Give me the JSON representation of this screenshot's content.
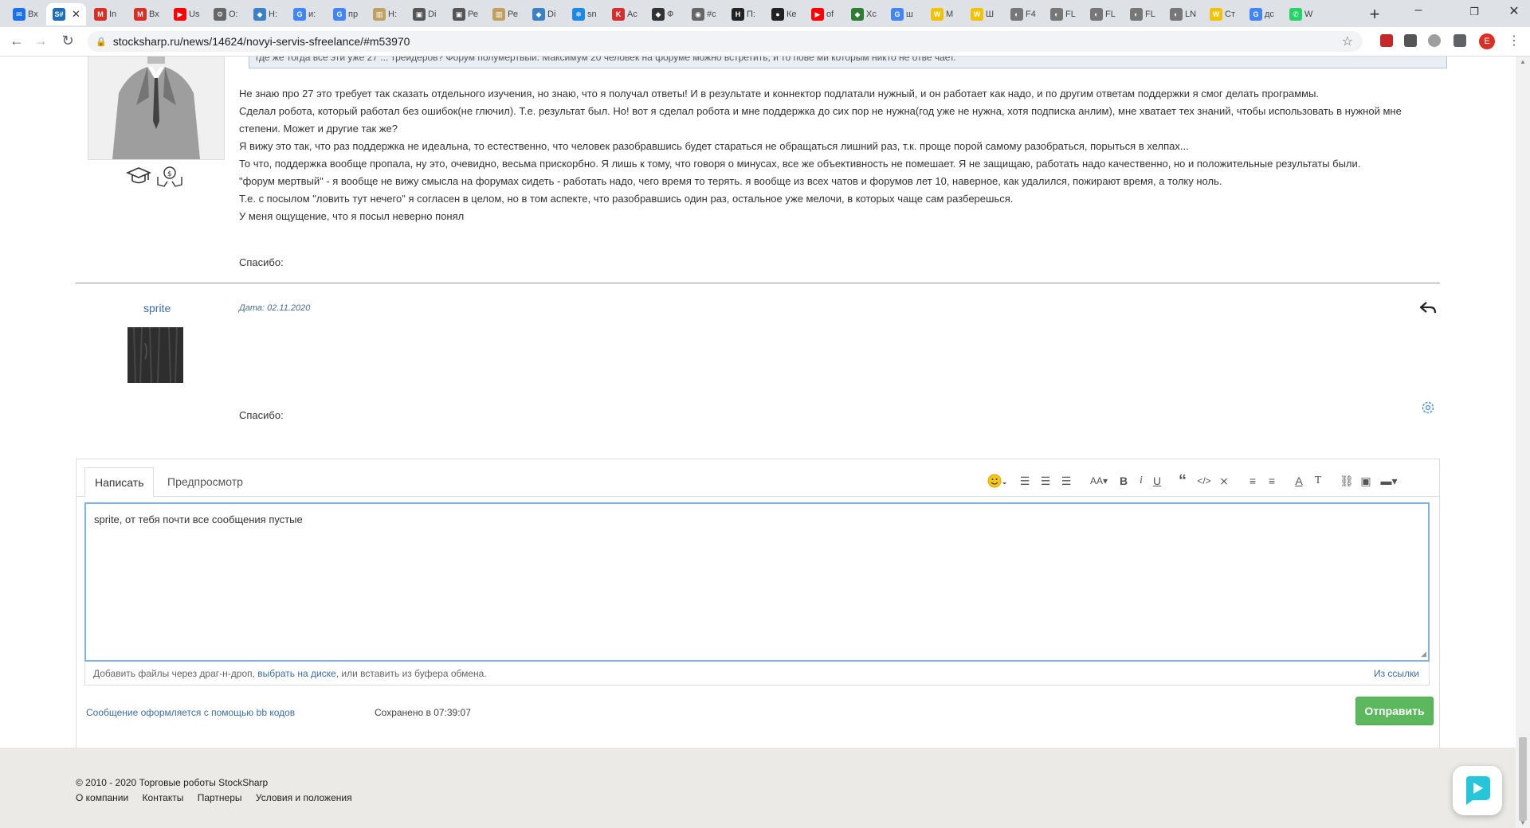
{
  "browser": {
    "tabs": [
      {
        "label": "Вх",
        "icon": "mail-icon",
        "color": "#1a73e8"
      },
      {
        "label": "",
        "icon": "stocksharp-icon",
        "color": "#1e6fb8",
        "active": true
      },
      {
        "label": "In",
        "icon": "gmail-icon",
        "color": "#d93025"
      },
      {
        "label": "Вх",
        "icon": "gmail-icon",
        "color": "#d93025"
      },
      {
        "label": "Us",
        "icon": "youtube-icon",
        "color": "#ff0000"
      },
      {
        "label": "O:",
        "icon": "gear-icon",
        "color": "#666666"
      },
      {
        "label": "Н:",
        "icon": "site-icon",
        "color": "#3b82c4"
      },
      {
        "label": "и:",
        "icon": "google-icon",
        "color": "#4285f4"
      },
      {
        "label": "пр",
        "icon": "google-icon",
        "color": "#4285f4"
      },
      {
        "label": "Н:",
        "icon": "chart-icon",
        "color": "#c0a060"
      },
      {
        "label": "Di",
        "icon": "photo-icon",
        "color": "#555555"
      },
      {
        "label": "Ре",
        "icon": "photo-icon",
        "color": "#555555"
      },
      {
        "label": "Ре",
        "icon": "chart-icon",
        "color": "#c0a060"
      },
      {
        "label": "Di",
        "icon": "site-icon",
        "color": "#3b82c4"
      },
      {
        "label": "sn",
        "icon": "snowflake-icon",
        "color": "#1e88e5"
      },
      {
        "label": "Ас",
        "icon": "kaspersky-icon",
        "color": "#d32f2f"
      },
      {
        "label": "Ф",
        "icon": "site-icon",
        "color": "#333333"
      },
      {
        "label": "#с",
        "icon": "camera-icon",
        "color": "#666666"
      },
      {
        "label": "П:",
        "icon": "h-icon",
        "color": "#222222"
      },
      {
        "label": "Ке",
        "icon": "github-icon",
        "color": "#222222"
      },
      {
        "label": "of",
        "icon": "youtube-icon",
        "color": "#ff0000"
      },
      {
        "label": "Хс",
        "icon": "site-icon",
        "color": "#2e7d32"
      },
      {
        "label": "ш",
        "icon": "google-icon",
        "color": "#4285f4"
      },
      {
        "label": "М",
        "icon": "w-icon",
        "color": "#f2c200"
      },
      {
        "label": "Ш",
        "icon": "w-icon",
        "color": "#f2c200"
      },
      {
        "label": "F4",
        "icon": "firefox-icon",
        "color": "#777777"
      },
      {
        "label": "FL",
        "icon": "firefox-icon",
        "color": "#777777"
      },
      {
        "label": "FL",
        "icon": "firefox-icon",
        "color": "#777777"
      },
      {
        "label": "FL",
        "icon": "firefox-icon",
        "color": "#777777"
      },
      {
        "label": "LN",
        "icon": "firefox-icon",
        "color": "#777777"
      },
      {
        "label": "Ст",
        "icon": "w-icon",
        "color": "#f2c200"
      },
      {
        "label": "дс",
        "icon": "google-icon",
        "color": "#4285f4"
      },
      {
        "label": "W",
        "icon": "whatsapp-icon",
        "color": "#25d366"
      }
    ],
    "url": "stocksharp.ru/news/14624/novyi-servis-sfreelance/#m53970",
    "profile_initial": "E"
  },
  "post1": {
    "quote_tail": "где же тогда все эти уже 27 ... трейдеров? Форум полумертвый. Максимум 20 человек на форуме можно встретить, и то пове ми которым никто не отве чает.",
    "lines": [
      "Не знаю про 27 это требует так сказать отдельного изучения, но знаю, что я получал ответы! И в результате и коннектор подлатали нужный, и он работает как надо, и по другим ответам поддержки я смог делать программы.",
      "Сделал робота, который работал без ошибок(не глючил). Т.е. результат был. Но! вот я сделал робота и мне поддержка до сих пор не нужна(год уже не нужна, хотя подписка анлим), мне хватает тех знаний, чтобы использовать в нужной мне степени. Может и другие так же?",
      "Я вижу это так, что раз поддержка не идеальна, то естественно, что человек разобравшись будет стараться не обращаться лишний раз, т.к. проще порой самому разобраться, порыться в хелпах...",
      "То что, поддержка вообще пропала, ну это, очевидно, весьма прискорбно. Я лишь к тому, что говоря о минусах, все же объективность не помешает. Я не защищаю, работать надо качественно, но и положительные результаты были.",
      "\"форум мертвый\" - я вообще не вижу смысла на форумах сидеть - работать надо, чего время то терять. я вообще из всех чатов и форумов лет 10, наверное, как удалился, пожирают время, а толку ноль.",
      "Т.е. с посылом \"ловить тут нечего\" я согласен в целом, но в том аспекте, что разобравшись один раз, остальное уже мелочи, в которых чаще сам разберешься.",
      "У меня ощущение, что я посыл неверно понял"
    ],
    "thanks": "Спасибо:"
  },
  "post2": {
    "author": "sprite",
    "date": "Дата: 02.11.2020",
    "thanks": "Спасибо:"
  },
  "editor": {
    "tab_write": "Написать",
    "tab_preview": "Предпросмотр",
    "text": "sprite, от тебя почти все сообщения пустые",
    "drop_text_1": "Добавить файлы через драг-н-дроп, ",
    "drop_link": "выбрать на диске",
    "drop_text_2": ", или вставить из буфера обмена.",
    "from_link": "Из ссылки",
    "bb_note": "Сообщение оформляется с помощью bb кодов",
    "saved": "Сохранено в 07:39:07",
    "send": "Отправить",
    "toolbar": {
      "font_size": "AA",
      "bold": "B",
      "italic": "i",
      "underline": "U",
      "quote": "“",
      "code": "</>",
      "text_color": "A",
      "clear_format": "T"
    }
  },
  "footer": {
    "copyright": "© 2010 - 2020 Торговые роботы StockSharp",
    "links": [
      "О компании",
      "Контакты",
      "Партнеры",
      "Условия и положения"
    ]
  },
  "colors": {
    "link": "#3c6ea8",
    "send_button": "#5cb85c",
    "footer_bg": "#eceae6",
    "textarea_border": "#7db3e6"
  }
}
